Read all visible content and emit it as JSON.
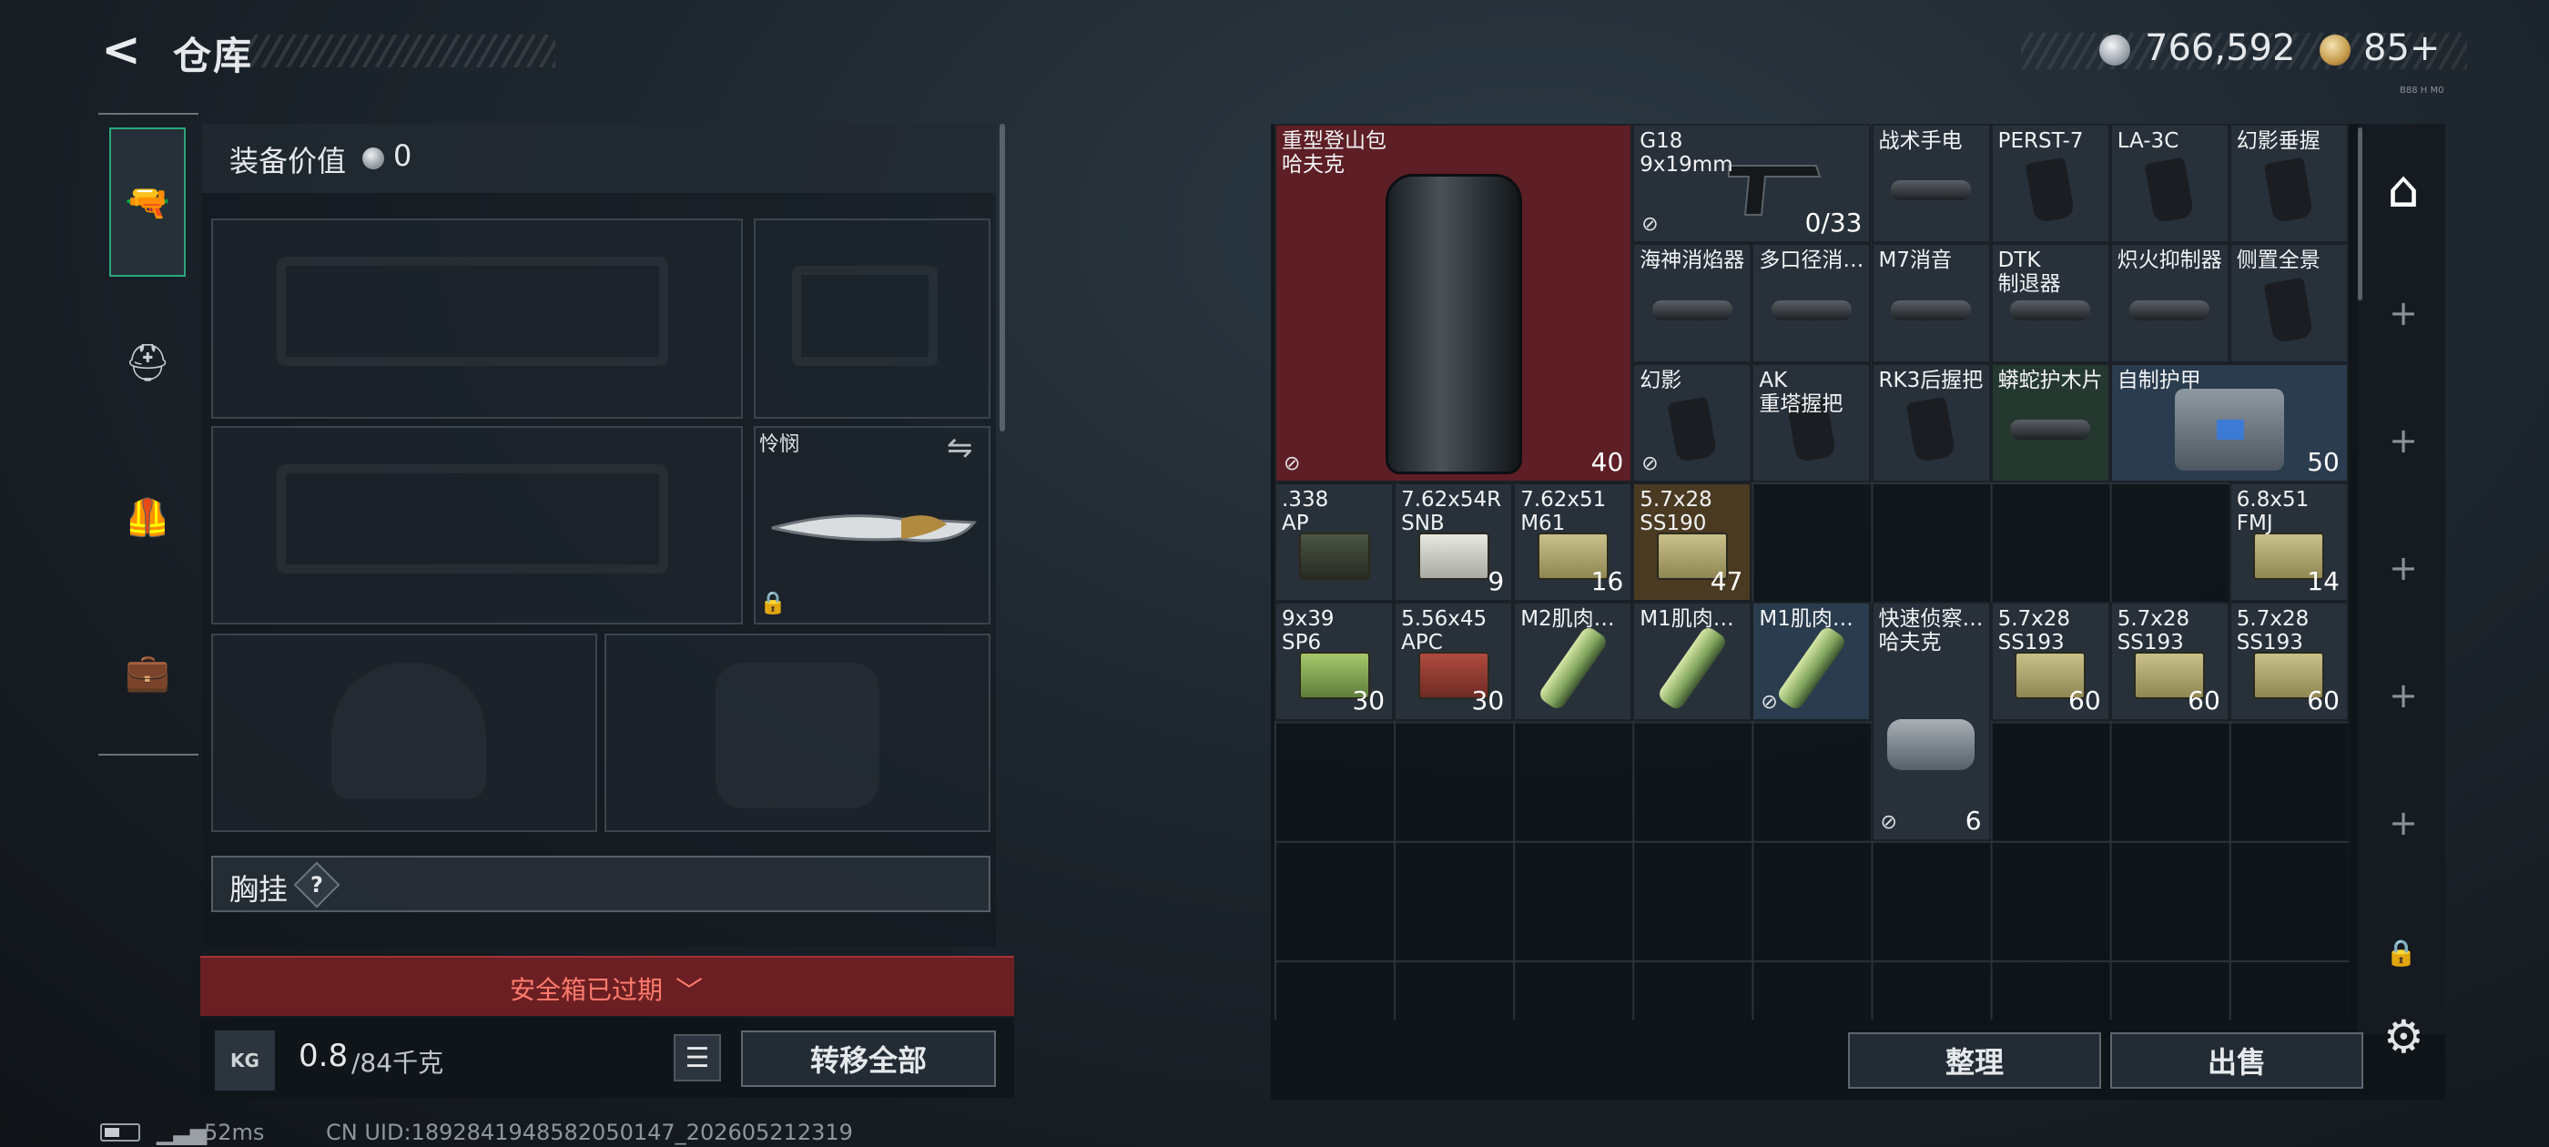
{
  "header": {
    "back_icon": "back-arrow-icon",
    "title": "仓库",
    "money": "766,592",
    "tokens": "85+",
    "tiny_text": "B88 H M0"
  },
  "nav": [
    {
      "name": "weapon",
      "icon": "pistol-icon",
      "glyph": "🔫",
      "active": true
    },
    {
      "name": "helmet",
      "icon": "helmet-icon",
      "glyph": "⛑"
    },
    {
      "name": "vest",
      "icon": "vest-icon",
      "glyph": "🦺"
    },
    {
      "name": "case",
      "icon": "briefcase-icon",
      "glyph": "💼"
    }
  ],
  "equip": {
    "label": "装备价值",
    "value": "0",
    "knife_name": "怜悯",
    "swap_glyph": "⇋",
    "lock_glyph": "🔒",
    "vest_label": "胸挂",
    "vest_help": "?",
    "safe_text": "安全箱已过期",
    "safe_chev": "﹀",
    "kg_icon": "KG",
    "weight_cur": "0.8",
    "weight_max": "/84千克",
    "list_glyph": "☰",
    "transfer_all": "转移全部"
  },
  "status": {
    "ping": "52ms",
    "uid": "CN UID:1892841948582050147_202605212319",
    "signal": "▁▃▅"
  },
  "stash": {
    "items": [
      {
        "name": "重型登山包\n哈夫克",
        "count": "40",
        "col": 0,
        "row": 0,
        "w": 3,
        "h": 3,
        "style": "red",
        "corner": "⊘",
        "art": "backpack"
      },
      {
        "name": "G18\n9x19mm",
        "count": "0/33",
        "col": 3,
        "row": 0,
        "w": 2,
        "h": 1,
        "style": "",
        "corner": "⊘",
        "art": "pistol"
      },
      {
        "name": "战术手电",
        "count": "",
        "col": 5,
        "row": 0,
        "w": 1,
        "h": 1,
        "art": "silencer"
      },
      {
        "name": "PERST-7",
        "count": "",
        "col": 6,
        "row": 0,
        "w": 1,
        "h": 1,
        "art": "grip"
      },
      {
        "name": "LA-3C",
        "count": "",
        "col": 7,
        "row": 0,
        "w": 1,
        "h": 1,
        "art": "grip"
      },
      {
        "name": "幻影垂握",
        "count": "",
        "col": 8,
        "row": 0,
        "w": 1,
        "h": 1,
        "art": "grip"
      },
      {
        "name": "海神消焰器",
        "count": "",
        "col": 3,
        "row": 1,
        "w": 1,
        "h": 1,
        "art": "silencer"
      },
      {
        "name": "多口径消…",
        "count": "",
        "col": 4,
        "row": 1,
        "w": 1,
        "h": 1,
        "art": "silencer"
      },
      {
        "name": "M7消音",
        "count": "",
        "col": 5,
        "row": 1,
        "w": 1,
        "h": 1,
        "art": "silencer"
      },
      {
        "name": "DTK\n制退器",
        "count": "",
        "col": 6,
        "row": 1,
        "w": 1,
        "h": 1,
        "art": "silencer"
      },
      {
        "name": "炽火抑制器",
        "count": "",
        "col": 7,
        "row": 1,
        "w": 1,
        "h": 1,
        "art": "silencer"
      },
      {
        "name": "侧置全景",
        "count": "",
        "col": 8,
        "row": 1,
        "w": 1,
        "h": 1,
        "art": "grip"
      },
      {
        "name": "幻影",
        "count": "",
        "col": 3,
        "row": 2,
        "w": 1,
        "h": 1,
        "corner": "⊘",
        "art": "grip"
      },
      {
        "name": "AK\n重塔握把",
        "count": "",
        "col": 4,
        "row": 2,
        "w": 1,
        "h": 1,
        "art": "grip"
      },
      {
        "name": "RK3后握把",
        "count": "",
        "col": 5,
        "row": 2,
        "w": 1,
        "h": 1,
        "art": "grip"
      },
      {
        "name": "蟒蛇护木片",
        "count": "",
        "col": 6,
        "row": 2,
        "w": 1,
        "h": 1,
        "style": "green",
        "art": "silencer"
      },
      {
        "name": "自制护甲",
        "count": "50",
        "col": 7,
        "row": 2,
        "w": 2,
        "h": 1,
        "style": "blue",
        "art": "armor"
      },
      {
        "name": ".338\nAP",
        "count": "",
        "col": 0,
        "row": 3,
        "w": 1,
        "h": 1,
        "art": "ammo k"
      },
      {
        "name": "7.62x54R\nSNB",
        "count": "9",
        "col": 1,
        "row": 3,
        "w": 1,
        "h": 1,
        "art": "ammo w"
      },
      {
        "name": "7.62x51\nM61",
        "count": "16",
        "col": 2,
        "row": 3,
        "w": 1,
        "h": 1,
        "art": "ammo"
      },
      {
        "name": "5.7x28\nSS190",
        "count": "47",
        "col": 3,
        "row": 3,
        "w": 1,
        "h": 1,
        "style": "gold",
        "art": "ammo"
      },
      {
        "name": "6.8x51\nFMJ",
        "count": "14",
        "col": 8,
        "row": 3,
        "w": 1,
        "h": 1,
        "art": "ammo"
      },
      {
        "name": "9x39\nSP6",
        "count": "30",
        "col": 0,
        "row": 4,
        "w": 1,
        "h": 1,
        "art": "ammo g"
      },
      {
        "name": "5.56x45\nAPC",
        "count": "30",
        "col": 1,
        "row": 4,
        "w": 1,
        "h": 1,
        "art": "ammo r"
      },
      {
        "name": "M2肌肉…",
        "count": "",
        "col": 2,
        "row": 4,
        "w": 1,
        "h": 1,
        "art": "tube"
      },
      {
        "name": "M1肌肉…",
        "count": "",
        "col": 3,
        "row": 4,
        "w": 1,
        "h": 1,
        "art": "tube"
      },
      {
        "name": "M1肌肉…",
        "count": "",
        "col": 4,
        "row": 4,
        "w": 1,
        "h": 1,
        "style": "blue",
        "corner": "⊘",
        "art": "tube"
      },
      {
        "name": "快速侦察…\n哈夫克",
        "count": "6",
        "col": 5,
        "row": 4,
        "w": 1,
        "h": 2,
        "corner": "⊘",
        "art": "bag"
      },
      {
        "name": "5.7x28\nSS193",
        "count": "60",
        "col": 6,
        "row": 4,
        "w": 1,
        "h": 1,
        "art": "ammo"
      },
      {
        "name": "5.7x28\nSS193",
        "count": "60",
        "col": 7,
        "row": 4,
        "w": 1,
        "h": 1,
        "art": "ammo"
      },
      {
        "name": "5.7x28\nSS193",
        "count": "60",
        "col": 8,
        "row": 4,
        "w": 1,
        "h": 1,
        "art": "ammo"
      }
    ],
    "side_main_glyph": "⌂",
    "plus_glyph": "+",
    "lock_glyph": "🔒",
    "settings_glyph": "⚙",
    "sort_label": "整理",
    "sell_label": "出售"
  },
  "colors": {
    "accent_green": "#2ba67c",
    "danger_red": "#6b1f22",
    "expired_text": "#ff7b6e"
  }
}
